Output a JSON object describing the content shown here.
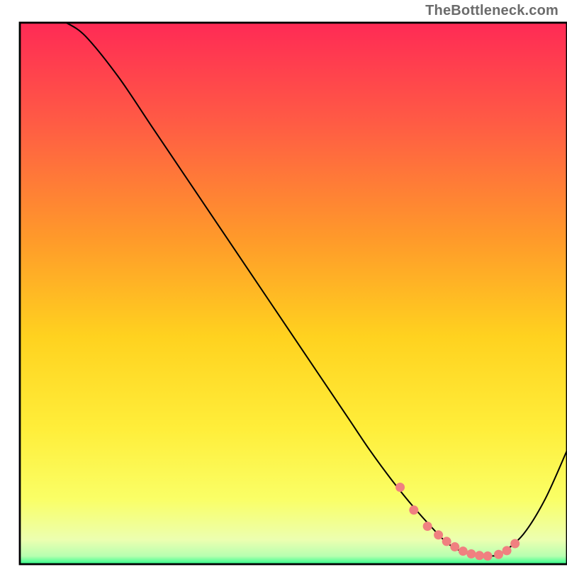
{
  "watermark": "TheBottleneck.com",
  "chart_data": {
    "type": "line",
    "title": "",
    "xlabel": "",
    "ylabel": "",
    "xlim": [
      0,
      100
    ],
    "ylim": [
      0,
      100
    ],
    "grid": false,
    "gradient_stops": [
      {
        "offset": 0.0,
        "color": "#ff2a55"
      },
      {
        "offset": 0.18,
        "color": "#ff5a45"
      },
      {
        "offset": 0.4,
        "color": "#ff9a2a"
      },
      {
        "offset": 0.58,
        "color": "#ffd21f"
      },
      {
        "offset": 0.75,
        "color": "#ffee3a"
      },
      {
        "offset": 0.88,
        "color": "#faff66"
      },
      {
        "offset": 0.955,
        "color": "#ecffb0"
      },
      {
        "offset": 0.985,
        "color": "#b7ffb0"
      },
      {
        "offset": 1.0,
        "color": "#2fff8a"
      }
    ],
    "series": [
      {
        "name": "bottleneck-curve",
        "color": "#000000",
        "x": [
          8.5,
          12,
          18,
          24,
          30,
          36,
          42,
          48,
          54,
          60,
          64,
          68,
          72,
          76,
          78,
          80,
          82,
          84,
          86,
          88,
          92,
          96,
          100
        ],
        "y": [
          100,
          97.5,
          90,
          81,
          72,
          63,
          54,
          45,
          36,
          27,
          21,
          15.5,
          10.5,
          6,
          4,
          2.7,
          1.9,
          1.5,
          1.5,
          2,
          5.5,
          12,
          21
        ]
      }
    ],
    "highlight_points": {
      "name": "sweet-spot",
      "color": "#f08080",
      "radius_px": 6.5,
      "x": [
        69.5,
        72.0,
        74.5,
        76.5,
        78.0,
        79.5,
        81.0,
        82.5,
        84.0,
        85.5,
        87.5,
        89.0,
        90.5
      ],
      "y": [
        14.2,
        10.0,
        7.0,
        5.4,
        4.2,
        3.2,
        2.4,
        1.9,
        1.6,
        1.5,
        1.8,
        2.5,
        3.8
      ]
    },
    "frame": {
      "x": 3.5,
      "y": 4,
      "w": 96.5,
      "h": 95.5
    }
  }
}
